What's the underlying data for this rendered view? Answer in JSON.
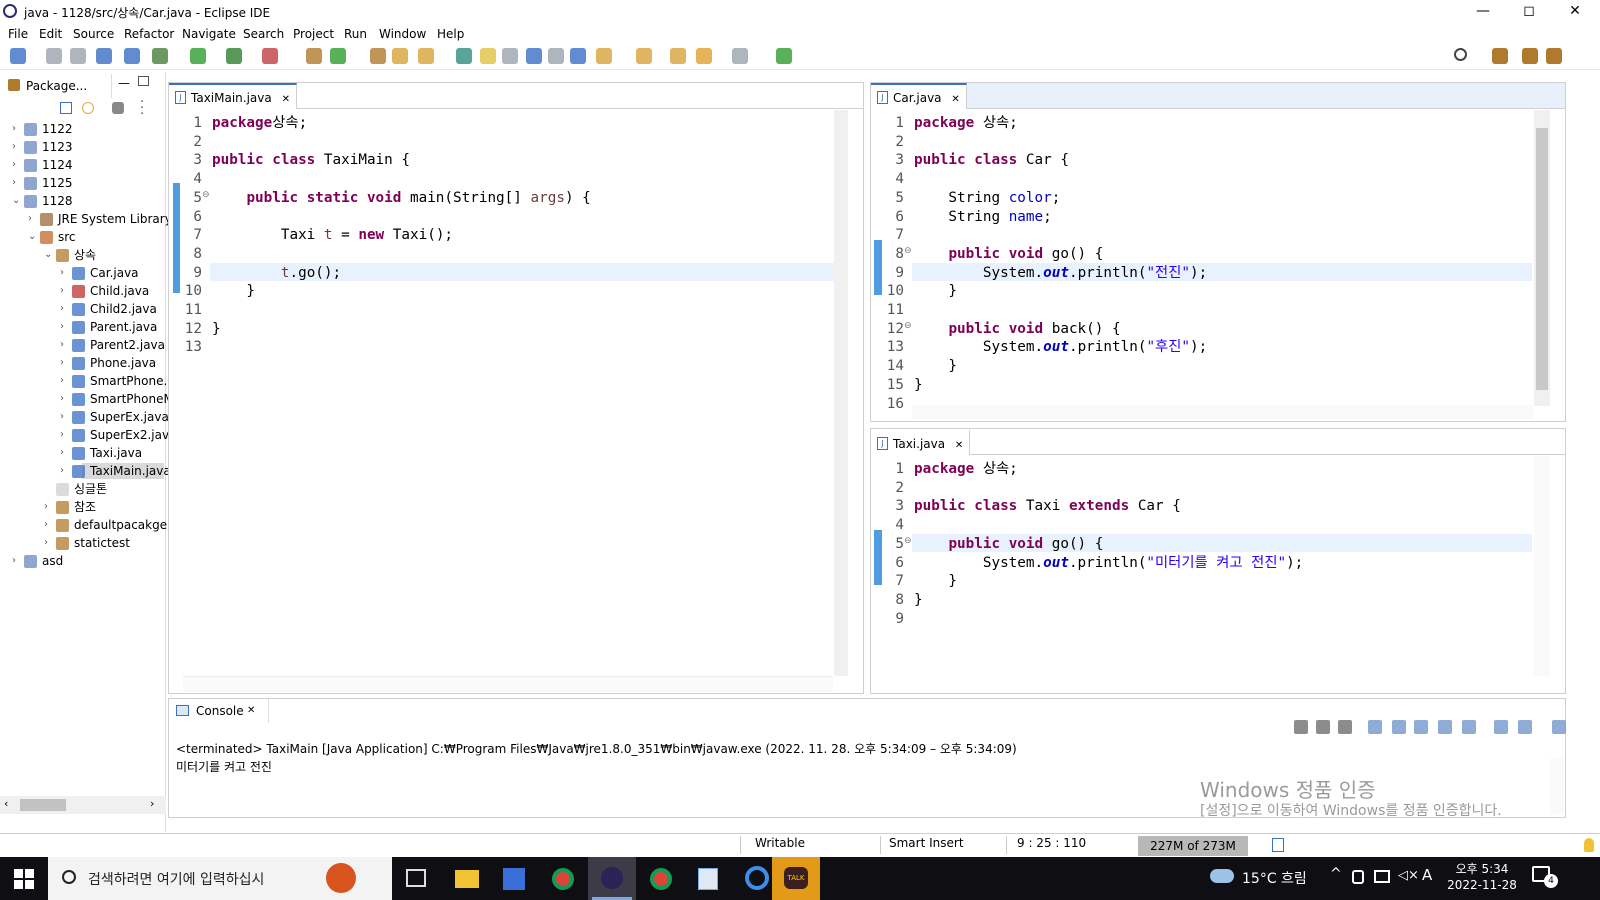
{
  "window": {
    "title": "java - 1128/src/상속/Car.java - Eclipse IDE",
    "minimize": "—",
    "maximize": "◻",
    "close": "✕"
  },
  "menu": [
    "File",
    "Edit",
    "Source",
    "Refactor",
    "Navigate",
    "Search",
    "Project",
    "Run",
    "Window",
    "Help"
  ],
  "explorer": {
    "tab": "Package...",
    "items": [
      {
        "label": "1122",
        "depth": 0,
        "arrow": "›",
        "icon": "project-icon"
      },
      {
        "label": "1123",
        "depth": 0,
        "arrow": "›",
        "icon": "project-icon"
      },
      {
        "label": "1124",
        "depth": 0,
        "arrow": "›",
        "icon": "project-icon"
      },
      {
        "label": "1125",
        "depth": 0,
        "arrow": "›",
        "icon": "project-icon"
      },
      {
        "label": "1128",
        "depth": 0,
        "arrow": "⌄",
        "icon": "project-icon"
      },
      {
        "label": "JRE System Library",
        "depth": 1,
        "arrow": "›",
        "icon": "library-icon"
      },
      {
        "label": "src",
        "depth": 1,
        "arrow": "⌄",
        "icon": "source-folder-icon"
      },
      {
        "label": "상속",
        "depth": 2,
        "arrow": "⌄",
        "icon": "package-icon"
      },
      {
        "label": "Car.java",
        "depth": 3,
        "arrow": "›",
        "icon": "java-file-icon"
      },
      {
        "label": "Child.java",
        "depth": 3,
        "arrow": "›",
        "icon": "java-file-error-icon"
      },
      {
        "label": "Child2.java",
        "depth": 3,
        "arrow": "›",
        "icon": "java-file-icon"
      },
      {
        "label": "Parent.java",
        "depth": 3,
        "arrow": "›",
        "icon": "java-file-icon"
      },
      {
        "label": "Parent2.java",
        "depth": 3,
        "arrow": "›",
        "icon": "java-file-icon"
      },
      {
        "label": "Phone.java",
        "depth": 3,
        "arrow": "›",
        "icon": "java-file-icon"
      },
      {
        "label": "SmartPhone.",
        "depth": 3,
        "arrow": "›",
        "icon": "java-file-icon"
      },
      {
        "label": "SmartPhoneM",
        "depth": 3,
        "arrow": "›",
        "icon": "java-file-icon"
      },
      {
        "label": "SuperEx.java",
        "depth": 3,
        "arrow": "›",
        "icon": "java-file-icon"
      },
      {
        "label": "SuperEx2.java",
        "depth": 3,
        "arrow": "›",
        "icon": "java-file-icon"
      },
      {
        "label": "Taxi.java",
        "depth": 3,
        "arrow": "›",
        "icon": "java-file-icon"
      },
      {
        "label": "TaxiMain.java",
        "depth": 3,
        "arrow": "›",
        "icon": "java-file-icon",
        "selected": true
      },
      {
        "label": "싱글톤",
        "depth": 2,
        "arrow": "",
        "icon": "empty-package-icon"
      },
      {
        "label": "참조",
        "depth": 2,
        "arrow": "›",
        "icon": "package-icon"
      },
      {
        "label": "defaultpacakge",
        "depth": 2,
        "arrow": "›",
        "icon": "package-icon"
      },
      {
        "label": "statictest",
        "depth": 2,
        "arrow": "›",
        "icon": "package-icon"
      },
      {
        "label": "asd",
        "depth": 0,
        "arrow": "›",
        "icon": "project-icon"
      }
    ]
  },
  "editors": {
    "taximain": {
      "tab": "TaxiMain.java",
      "close": "✕",
      "lines": [
        "1",
        "2",
        "3",
        "4",
        "5",
        "6",
        "7",
        "8",
        "9",
        "10",
        "11",
        "12",
        "13"
      ]
    },
    "car": {
      "tab": "Car.java",
      "close": "✕",
      "lines": [
        "1",
        "2",
        "3",
        "4",
        "5",
        "6",
        "7",
        "8",
        "9",
        "10",
        "11",
        "12",
        "13",
        "14",
        "15",
        "16"
      ]
    },
    "taxi": {
      "tab": "Taxi.java",
      "close": "✕",
      "lines": [
        "1",
        "2",
        "3",
        "4",
        "5",
        "6",
        "7",
        "8",
        "9"
      ]
    }
  },
  "code": {
    "taximain": [
      [
        [
          "kw",
          "package"
        ],
        [
          "",
          "상속;"
        ]
      ],
      [],
      [
        [
          "kw",
          "public class"
        ],
        [
          "",
          " TaxiMain {"
        ]
      ],
      [],
      [
        [
          "",
          "    "
        ],
        [
          "kw",
          "public static void"
        ],
        [
          "",
          " main(String[] "
        ],
        [
          "var",
          "args"
        ],
        [
          "",
          ") {"
        ]
      ],
      [],
      [
        [
          "",
          "        Taxi "
        ],
        [
          "var",
          "t"
        ],
        [
          "",
          " = "
        ],
        [
          "kw",
          "new"
        ],
        [
          "",
          " Taxi();"
        ]
      ],
      [],
      [
        [
          "",
          "        "
        ],
        [
          "var",
          "t"
        ],
        [
          "",
          ".go();"
        ]
      ],
      [
        [
          "",
          "    }"
        ]
      ],
      [],
      [
        [
          "",
          "}"
        ]
      ],
      []
    ],
    "car": [
      [
        [
          "kw",
          "package"
        ],
        [
          "",
          " 상속;"
        ]
      ],
      [],
      [
        [
          "kw",
          "public class"
        ],
        [
          "",
          " Car {"
        ]
      ],
      [],
      [
        [
          "",
          "    String "
        ],
        [
          "fld",
          "color"
        ],
        [
          "",
          ";"
        ]
      ],
      [
        [
          "",
          "    String "
        ],
        [
          "fld",
          "name"
        ],
        [
          "",
          ";"
        ]
      ],
      [],
      [
        [
          "",
          "    "
        ],
        [
          "kw",
          "public void"
        ],
        [
          "",
          " go() {"
        ]
      ],
      [
        [
          "",
          "        System."
        ],
        [
          "stat",
          "out"
        ],
        [
          "",
          "."
        ],
        [
          "",
          "println"
        ],
        [
          "",
          "("
        ],
        [
          "str",
          "\"전진\""
        ],
        [
          "",
          ");"
        ]
      ],
      [
        [
          "",
          "    }"
        ]
      ],
      [],
      [
        [
          "",
          "    "
        ],
        [
          "kw",
          "public void"
        ],
        [
          "",
          " back() {"
        ]
      ],
      [
        [
          "",
          "        System."
        ],
        [
          "stat",
          "out"
        ],
        [
          "",
          "."
        ],
        [
          "",
          "println"
        ],
        [
          "",
          "("
        ],
        [
          "str",
          "\"후진\""
        ],
        [
          "",
          ");"
        ]
      ],
      [
        [
          "",
          "    }"
        ]
      ],
      [
        [
          "",
          "}"
        ]
      ],
      []
    ],
    "taxi": [
      [
        [
          "kw",
          "package"
        ],
        [
          "",
          " 상속;"
        ]
      ],
      [],
      [
        [
          "kw",
          "public class"
        ],
        [
          "",
          " Taxi "
        ],
        [
          "kw",
          "extends"
        ],
        [
          "",
          " Car {"
        ]
      ],
      [],
      [
        [
          "",
          "    "
        ],
        [
          "kw",
          "public void"
        ],
        [
          "",
          " go() {"
        ]
      ],
      [
        [
          "",
          "        System."
        ],
        [
          "stat",
          "out"
        ],
        [
          "",
          ".println("
        ],
        [
          "str",
          "\"미터기를 켜고 전진\""
        ],
        [
          "",
          ");"
        ]
      ],
      [
        [
          "",
          "    }"
        ]
      ],
      [
        [
          "",
          "}"
        ]
      ],
      []
    ]
  },
  "console": {
    "tab": "Console",
    "header": "<terminated> TaxiMain [Java Application] C:₩Program Files₩Java₩jre1.8.0_351₩bin₩javaw.exe  (2022. 11. 28. 오후 5:34:09 – 오후 5:34:09)",
    "output": "미터기를 켜고 전진"
  },
  "watermark": {
    "line1": "Windows 정품 인증",
    "line2": "[설정]으로 이동하여 Windows를 정품 인증합니다."
  },
  "status": {
    "mode": "Writable",
    "insert": "Smart Insert",
    "position": "9 : 25 : 110",
    "memory": "227M of 273M"
  },
  "taskbar": {
    "search_placeholder": "검색하려면 여기에 입력하십시",
    "weather": "15°C 흐림",
    "time": "오후 5:34",
    "date": "2022-11-28",
    "notif": "4",
    "ime": "A"
  }
}
